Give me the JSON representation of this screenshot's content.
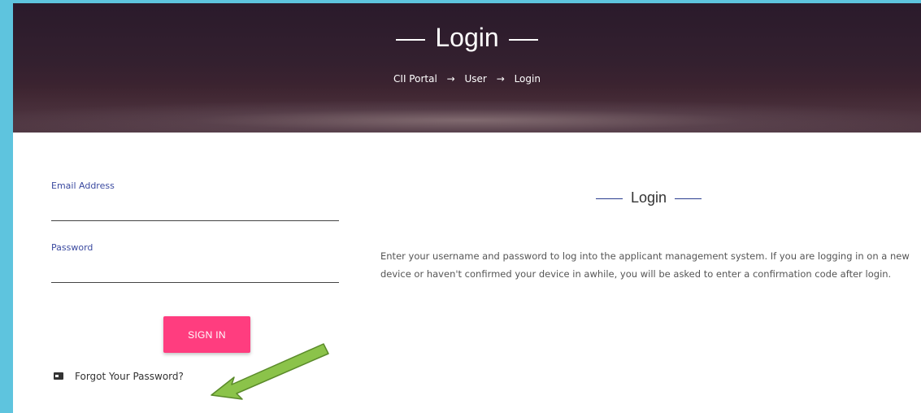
{
  "header": {
    "title": "Login",
    "breadcrumb": [
      "CII Portal",
      "User",
      "Login"
    ],
    "separator": "→"
  },
  "form": {
    "email_label": "Email Address",
    "email_value": "",
    "password_label": "Password",
    "password_value": "",
    "signin_label": "SIGN IN",
    "forgot_label": "Forgot Your Password?"
  },
  "info": {
    "title": "Login",
    "text": "Enter your username and password to log into the applicant management system. If you are logging in on a new device or haven't confirmed your device in awhile, you will be asked to enter a confirmation code after login."
  },
  "colors": {
    "accent": "#ff3d7f",
    "label": "#3b4aa0",
    "frame_bg": "#5ec4de",
    "callout_arrow": "#8bc34a"
  },
  "icons": {
    "forgot": "id-card-icon",
    "callout": "green-arrow-icon"
  }
}
